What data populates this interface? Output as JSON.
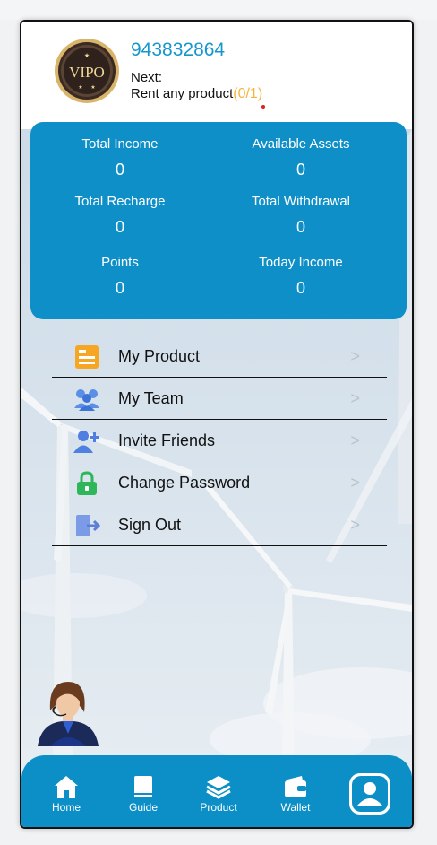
{
  "user": {
    "id": "943832864",
    "next_label": "Next:",
    "rent_text": "Rent any product",
    "rent_progress": "(0/1)",
    "badge_text": "VIPO"
  },
  "stats": [
    {
      "label": "Total Income",
      "value": "0"
    },
    {
      "label": "Available Assets",
      "value": "0"
    },
    {
      "label": "Total Recharge",
      "value": "0"
    },
    {
      "label": "Total Withdrawal",
      "value": "0"
    },
    {
      "label": "Points",
      "value": "0"
    },
    {
      "label": "Today Income",
      "value": "0"
    }
  ],
  "menu": [
    {
      "label": "My Product",
      "icon": "product-card-icon",
      "chevron": ">"
    },
    {
      "label": "My Team",
      "icon": "team-icon",
      "chevron": ">"
    },
    {
      "label": "Invite Friends",
      "icon": "invite-friends-icon",
      "chevron": ">"
    },
    {
      "label": "Change Password",
      "icon": "lock-icon",
      "chevron": ">"
    },
    {
      "label": "Sign Out",
      "icon": "sign-out-icon",
      "chevron": ">"
    }
  ],
  "tabs": [
    {
      "label": "Home",
      "icon": "home-icon"
    },
    {
      "label": "Guide",
      "icon": "book-icon"
    },
    {
      "label": "Product",
      "icon": "layers-icon"
    },
    {
      "label": "Wallet",
      "icon": "wallet-icon"
    },
    {
      "label": "",
      "icon": "profile-icon"
    }
  ],
  "colors": {
    "accent": "#0e8fc8",
    "id_text": "#1597cc",
    "progress": "#f4b63a"
  }
}
